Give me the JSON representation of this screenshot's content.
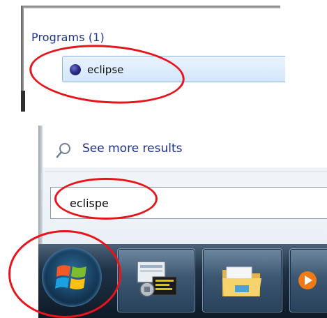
{
  "start_menu": {
    "programs_heading": "Programs (1)",
    "result": {
      "label": "eclipse",
      "icon": "eclipse-icon"
    },
    "see_more": {
      "label": "See more results",
      "icon": "magnifier-icon"
    },
    "search": {
      "value": "eclispe"
    }
  },
  "taskbar": {
    "start_button": {
      "icon": "windows-logo-icon"
    },
    "pinned": [
      {
        "icon": "security-app-icon"
      },
      {
        "icon": "folder-icon"
      },
      {
        "icon": "media-player-icon"
      }
    ]
  },
  "colors": {
    "annotation": "#e8141b",
    "link_text": "#1e3287",
    "selection_bg": "#d3e6fb"
  }
}
